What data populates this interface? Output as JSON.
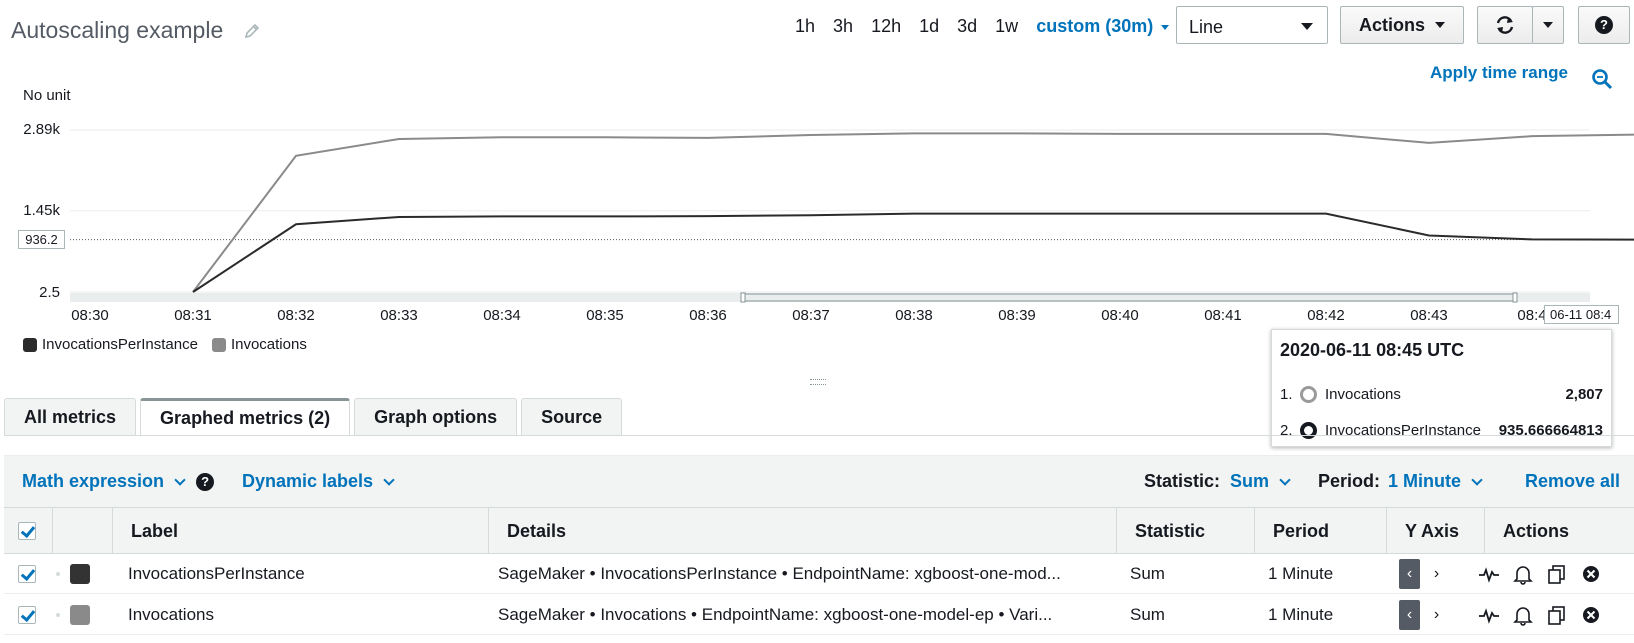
{
  "header": {
    "title": "Autoscaling example",
    "time_ranges": [
      "1h",
      "3h",
      "12h",
      "1d",
      "3d",
      "1w"
    ],
    "custom_range": "custom (30m)",
    "graph_type": "Line",
    "actions_label": "Actions",
    "help_label": "?",
    "apply_time_range": "Apply time range"
  },
  "chart_data": {
    "type": "line",
    "ylabel": "No unit",
    "y_ticks": [
      "2.89k",
      "1.45k",
      "2.5"
    ],
    "y_tick_values": [
      2890,
      1450,
      2.5
    ],
    "ylim": [
      2.5,
      2890
    ],
    "reference_value": "936.2",
    "x": [
      "08:30",
      "08:31",
      "08:32",
      "08:33",
      "08:34",
      "08:35",
      "08:36",
      "08:37",
      "08:38",
      "08:39",
      "08:40",
      "08:41",
      "08:42",
      "08:43",
      "08:44",
      "08:45"
    ],
    "x_ticks": [
      "08:30",
      "08:31",
      "08:32",
      "08:33",
      "08:34",
      "08:35",
      "08:36",
      "08:37",
      "08:38",
      "08:39",
      "08:40",
      "08:41",
      "08:42",
      "08:43",
      "08:4"
    ],
    "cursor_label": "06-11 08:4",
    "series": [
      {
        "name": "Invocations",
        "color": "#8a8a8a",
        "values": [
          null,
          2.5,
          2430,
          2730,
          2760,
          2760,
          2750,
          2800,
          2830,
          2830,
          2820,
          2820,
          2820,
          2660,
          2780,
          2807
        ]
      },
      {
        "name": "InvocationsPerInstance",
        "color": "#2b2b2b",
        "values": [
          null,
          2.5,
          1210,
          1340,
          1350,
          1350,
          1355,
          1370,
          1400,
          1400,
          1400,
          1400,
          1400,
          1010,
          940,
          935.67
        ]
      }
    ],
    "grid": true,
    "legend_position": "bottom-left"
  },
  "legend": [
    {
      "label": "InvocationsPerInstance",
      "color": "#2b2b2b"
    },
    {
      "label": "Invocations",
      "color": "#8a8a8a"
    }
  ],
  "tooltip": {
    "title": "2020-06-11 08:45 UTC",
    "rows": [
      {
        "index": "1.",
        "name": "Invocations",
        "value": "2,807",
        "color": "#8a8a8a"
      },
      {
        "index": "2.",
        "name": "InvocationsPerInstance",
        "value": "935.666664813",
        "color": "#16191f"
      }
    ]
  },
  "tabs": [
    {
      "label": "All metrics",
      "active": false
    },
    {
      "label": "Graphed metrics (2)",
      "active": true
    },
    {
      "label": "Graph options",
      "active": false
    },
    {
      "label": "Source",
      "active": false
    }
  ],
  "toolbar": {
    "math_expression": "Math expression",
    "dynamic_labels": "Dynamic labels",
    "statistic_label": "Statistic:",
    "statistic_value": "Sum",
    "period_label": "Period:",
    "period_value": "1 Minute",
    "remove_all": "Remove all"
  },
  "table": {
    "columns": [
      "Label",
      "Details",
      "Statistic",
      "Period",
      "Y Axis",
      "Actions"
    ],
    "rows": [
      {
        "color": "#333333",
        "label": "InvocationsPerInstance",
        "details": "SageMaker • InvocationsPerInstance • EndpointName: xgboost-one-mod...",
        "statistic": "Sum",
        "period": "1 Minute"
      },
      {
        "color": "#8a8a8a",
        "label": "Invocations",
        "details": "SageMaker • Invocations • EndpointName: xgboost-one-model-ep • Vari...",
        "statistic": "Sum",
        "period": "1 Minute"
      }
    ]
  }
}
